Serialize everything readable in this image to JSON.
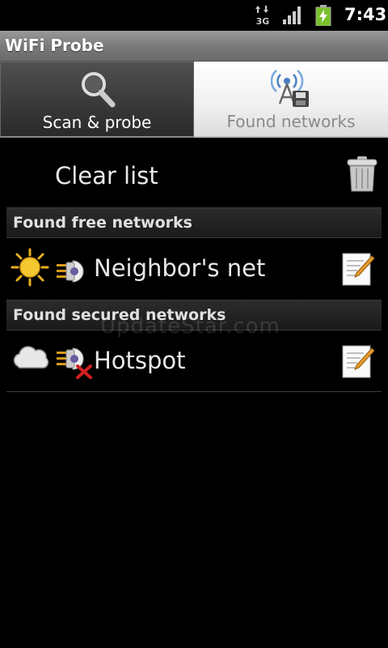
{
  "status_bar": {
    "network_type": "3G",
    "time": "7:43",
    "icons": [
      "3g-data-icon",
      "signal-strength-icon",
      "battery-charging-icon"
    ]
  },
  "app": {
    "title": "WiFi Probe"
  },
  "tabs": [
    {
      "label": "Scan & probe",
      "icon": "magnifier-icon",
      "selected": true
    },
    {
      "label": "Found networks",
      "icon": "wifi-antenna-save-icon",
      "selected": false
    }
  ],
  "clear_list": {
    "label": "Clear list",
    "icon": "trash-icon"
  },
  "sections": {
    "free": {
      "header": "Found free networks",
      "networks": [
        {
          "name": "Neighbor's net",
          "weather_icon": "sun-icon",
          "status_icon": "plug-icon",
          "action_icon": "edit-icon"
        }
      ]
    },
    "secured": {
      "header": "Found secured networks",
      "networks": [
        {
          "name": "Hotspot",
          "weather_icon": "cloud-icon",
          "status_icon": "plug-disconnected-icon",
          "action_icon": "edit-icon"
        }
      ]
    }
  },
  "watermark": "UpdateStar.com",
  "colors": {
    "background": "#000000",
    "titlebar": "#7a7a7a",
    "selected_tab": "#383838",
    "unselected_tab": "#f0f0f0",
    "section_header": "#222222"
  }
}
